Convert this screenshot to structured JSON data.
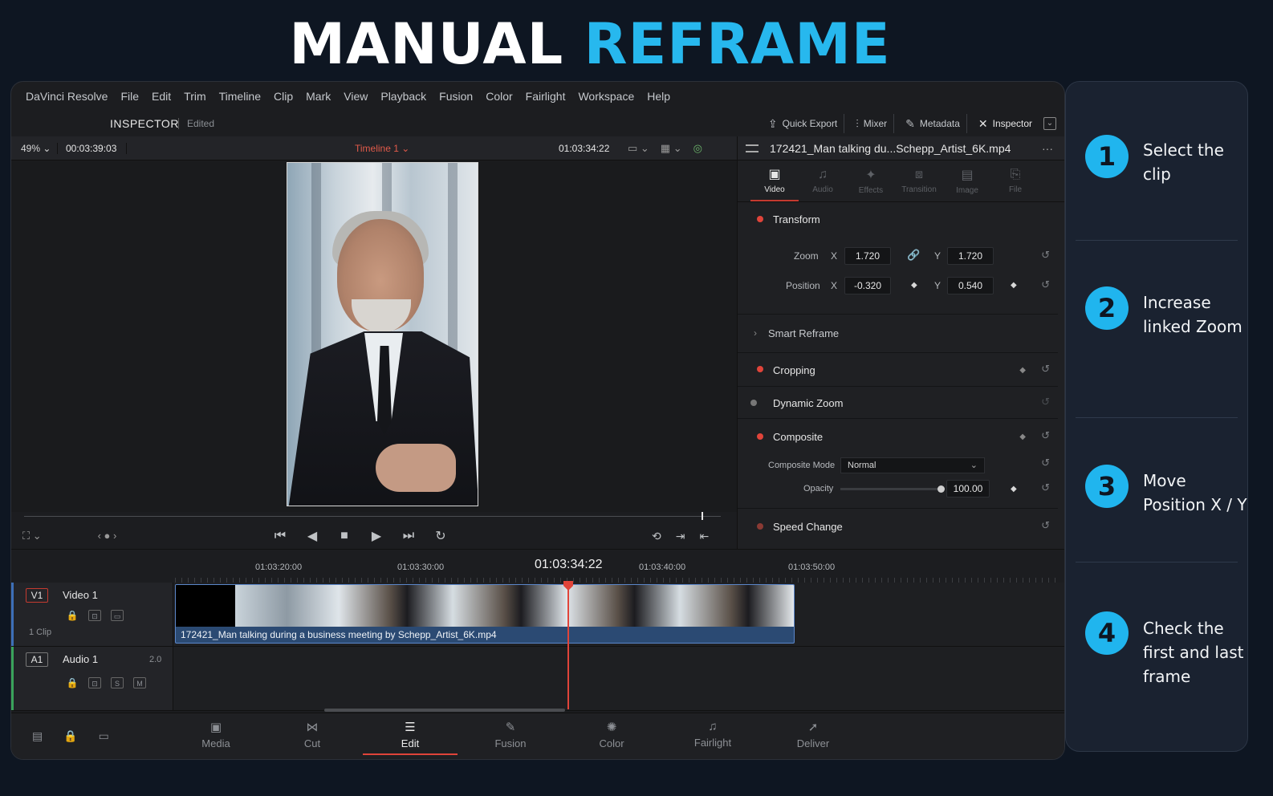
{
  "headline": {
    "part1": "MANUAL",
    "part2": "REFRAME"
  },
  "colors": {
    "accent": "#27b8ee",
    "edit_red": "#e0443a",
    "clip_blue": "#2b4a73"
  },
  "menu": [
    "DaVinci Resolve",
    "File",
    "Edit",
    "Trim",
    "Timeline",
    "Clip",
    "Mark",
    "View",
    "Playback",
    "Fusion",
    "Color",
    "Fairlight",
    "Workspace",
    "Help"
  ],
  "toolbar": {
    "page_title": "INSPECTOR",
    "status": "Edited",
    "tools": [
      {
        "icon": "export-icon",
        "label": "Quick Export"
      },
      {
        "icon": "mixer-icon",
        "label": "Mixer"
      },
      {
        "icon": "metadata-icon",
        "label": "Metadata"
      },
      {
        "icon": "inspector-icon",
        "label": "Inspector"
      }
    ]
  },
  "viewer": {
    "zoom": "49%",
    "source_timecode": "00:03:39:03",
    "timeline_name": "Timeline 1",
    "record_timecode": "01:03:34:22"
  },
  "inspector": {
    "clip_name": "172421_Man talking du...Schepp_Artist_6K.mp4",
    "tabs": [
      {
        "label": "Video",
        "icon": "video-icon",
        "active": true
      },
      {
        "label": "Audio",
        "icon": "audio-icon",
        "active": false
      },
      {
        "label": "Effects",
        "icon": "effects-icon",
        "active": false
      },
      {
        "label": "Transition",
        "icon": "transition-icon",
        "active": false
      },
      {
        "label": "Image",
        "icon": "image-icon",
        "active": false
      },
      {
        "label": "File",
        "icon": "file-icon",
        "active": false
      }
    ],
    "transform": {
      "title": "Transform",
      "zoom_label": "Zoom",
      "zoom_x": "1.720",
      "zoom_y": "1.720",
      "position_label": "Position",
      "position_x": "-0.320",
      "position_y": "0.540",
      "x_axis": "X",
      "y_axis": "Y"
    },
    "smart_reframe": "Smart Reframe",
    "cropping": "Cropping",
    "dynamic_zoom": "Dynamic Zoom",
    "composite": {
      "title": "Composite",
      "mode_label": "Composite Mode",
      "mode_value": "Normal",
      "opacity_label": "Opacity",
      "opacity_value": "100.00"
    },
    "speed_change": "Speed Change"
  },
  "timeline": {
    "ruler_marks": [
      "01:03:20:00",
      "01:03:30:00",
      "01:03:40:00",
      "01:03:50:00"
    ],
    "current": "01:03:34:22",
    "video_track": {
      "id": "V1",
      "name": "Video 1",
      "clip_count": "1 Clip"
    },
    "audio_track": {
      "id": "A1",
      "name": "Audio 1",
      "channels": "2.0",
      "solo": "S",
      "mute": "M"
    },
    "clip_label": "172421_Man talking during a business meeting by Schepp_Artist_6K.mp4"
  },
  "pages": [
    {
      "label": "Media",
      "icon": "media-icon",
      "active": false
    },
    {
      "label": "Cut",
      "icon": "cut-icon",
      "active": false
    },
    {
      "label": "Edit",
      "icon": "edit-icon",
      "active": true
    },
    {
      "label": "Fusion",
      "icon": "fusion-icon",
      "active": false
    },
    {
      "label": "Color",
      "icon": "color-icon",
      "active": false
    },
    {
      "label": "Fairlight",
      "icon": "fairlight-icon",
      "active": false
    },
    {
      "label": "Deliver",
      "icon": "deliver-icon",
      "active": false
    }
  ],
  "steps": [
    {
      "num": "1",
      "text": "Select the clip"
    },
    {
      "num": "2",
      "text": "Increase linked Zoom"
    },
    {
      "num": "3",
      "text": "Move Position X / Y"
    },
    {
      "num": "4",
      "text": "Check the first and last frame"
    }
  ]
}
